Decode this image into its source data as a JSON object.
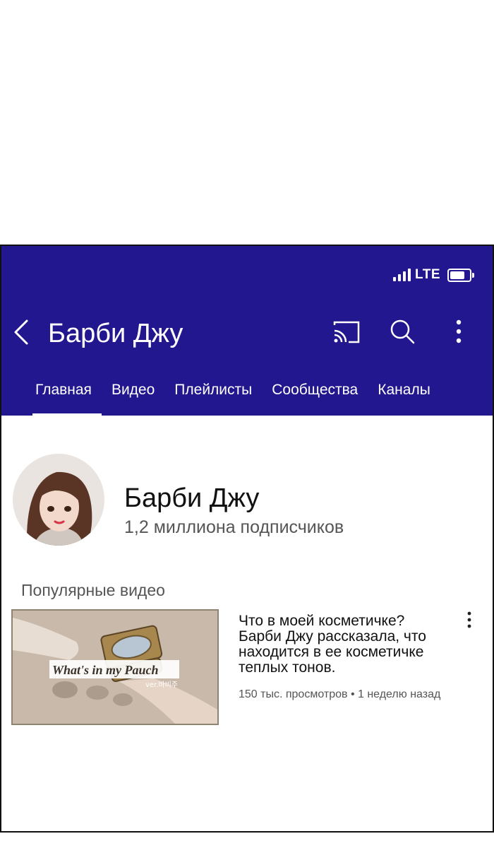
{
  "status_bar": {
    "network": "LTE",
    "signal_icon": "signal-bars-icon",
    "battery_icon": "battery-icon"
  },
  "toolbar": {
    "back_icon": "chevron-left-icon",
    "title": "Барби Джу",
    "cast_icon": "cast-icon",
    "search_icon": "search-icon",
    "more_icon": "more-vertical-icon"
  },
  "tabs": [
    {
      "label": "Главная",
      "active": true
    },
    {
      "label": "Видео",
      "active": false
    },
    {
      "label": "Плейлисты",
      "active": false
    },
    {
      "label": "Сообщества",
      "active": false
    },
    {
      "label": "Каналы",
      "active": false
    }
  ],
  "channel": {
    "name": "Барби Джу",
    "subscribers": "1,2 миллиона подписчиков"
  },
  "popular": {
    "section_title": "Популярные видео",
    "video": {
      "thumbnail_caption": "What's in my Pauch",
      "thumbnail_subcaption": "ver.바비주",
      "title": "Что в моей косметичке? Барби Джу рассказала, что находится в ее косметичке теплых тонов.",
      "meta": "150 тыс. просмотров • 1 неделю назад"
    }
  },
  "colors": {
    "header_bg": "#22178f",
    "text_primary": "#111111",
    "text_secondary": "#555555"
  }
}
